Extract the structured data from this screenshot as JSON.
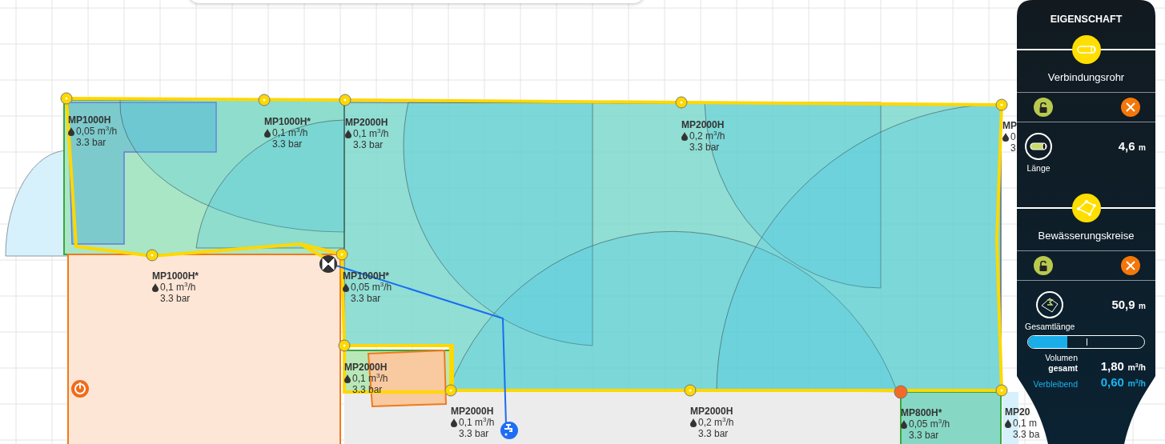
{
  "nozzles": [
    {
      "model": "MP1000H",
      "flow": "0,05 m$^{3}$/h",
      "pressure": "3.3 bar"
    },
    {
      "model": "MP1000H*",
      "flow": "0,1 m$^{3}$/h",
      "pressure": "3.3 bar"
    },
    {
      "model": "MP2000H",
      "flow": "0,1 m$^{3}$/h",
      "pressure": "3.3 bar"
    },
    {
      "model": "MP2000H",
      "flow": "0,2 m$^{3}$/h",
      "pressure": "3.3 bar"
    },
    {
      "model": "MP",
      "flow": "0",
      "pressure": "3"
    },
    {
      "model": "MP1000H*",
      "flow": "0,1 m$^{3}$/h",
      "pressure": "3.3 bar"
    },
    {
      "model": "MP1000H*",
      "flow": "0,05 m$^{3}$/h",
      "pressure": "3.3 bar"
    },
    {
      "model": "MP2000H",
      "flow": "0,1 m$^{3}$/h",
      "pressure": "3.3 bar"
    },
    {
      "model": "MP2000H",
      "flow": "0,1 m$^{3}$/h",
      "pressure": "3.3 bar"
    },
    {
      "model": "MP2000H",
      "flow": "0,2 m$^{3}$/h",
      "pressure": "3.3 bar"
    },
    {
      "model": "MP800H*",
      "flow": "0,05 m$^{3}$/h",
      "pressure": "3.3 bar"
    },
    {
      "model": "MP20",
      "flow": "0,1 m",
      "pressure": "3.3 ba"
    }
  ],
  "panel": {
    "title": "EIGENSCHAFT",
    "sections": [
      {
        "kind": "pipe",
        "name": "Verbindungsrohr",
        "stat_label": "Länge",
        "stat_value": "4,6",
        "stat_unit": "m"
      },
      {
        "kind": "zones",
        "name": "Bewässerungskreise",
        "stat_label": "Gesamtlänge",
        "stat_value": "50,9",
        "stat_unit": "m"
      }
    ],
    "volume": {
      "level": 0.34,
      "label_line1": "Volumen",
      "label_line2": "gesamt",
      "total": "1,80",
      "total_unit": "m$^{3}$/h",
      "remaining_label": "Verbleibend",
      "remaining": "0,60",
      "remaining_unit": "m$^{3}$/h"
    }
  }
}
